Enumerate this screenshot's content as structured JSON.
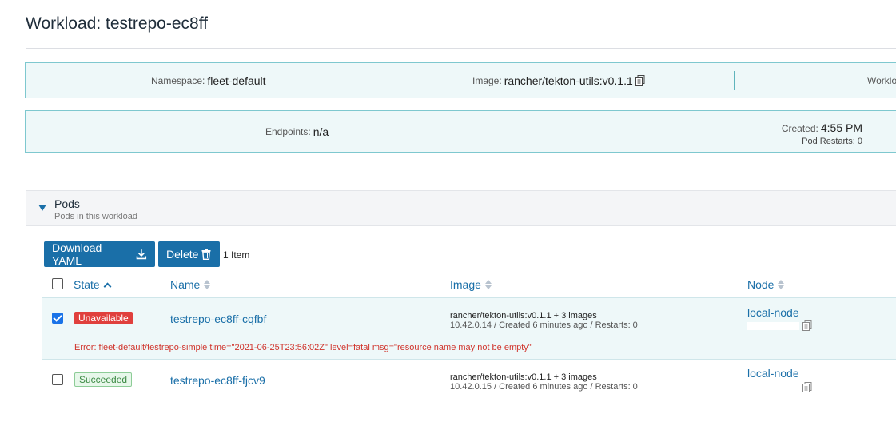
{
  "page": {
    "title": "Workload: testrepo-ec8ff"
  },
  "info": {
    "namespace_label": "Namespace:",
    "namespace_value": "fleet-default",
    "image_label": "Image:",
    "image_value": "rancher/tekton-utils:v0.1.1",
    "workload_label": "Worklo",
    "endpoints_label": "Endpoints:",
    "endpoints_value": "n/a",
    "created_label": "Created:",
    "created_value": "4:55 PM",
    "restarts_text": "Pod Restarts: 0"
  },
  "pods": {
    "title": "Pods",
    "subtitle": "Pods in this workload",
    "download_label": "Download YAML",
    "delete_label": "Delete",
    "count": "1 Item",
    "columns": {
      "state": "State",
      "name": "Name",
      "image": "Image",
      "node": "Node"
    },
    "rows": [
      {
        "checked": true,
        "state": "Unavailable",
        "name": "testrepo-ec8ff-cqfbf",
        "image": "rancher/tekton-utils:v0.1.1 + 3 images",
        "image_detail": "10.42.0.14 / Created 6 minutes ago / Restarts: 0",
        "node": "local-node",
        "error": "Error: fleet-default/testrepo-simple time=\"2021-06-25T23:56:02Z\" level=fatal msg=\"resource name may not be empty\""
      },
      {
        "checked": false,
        "state": "Succeeded",
        "name": "testrepo-ec8ff-fjcv9",
        "image": "rancher/tekton-utils:v0.1.1 + 3 images",
        "image_detail": "10.42.0.15 / Created 6 minutes ago / Restarts: 0",
        "node": "local-node"
      }
    ]
  },
  "colors": {
    "accent": "#1a6fa8",
    "error": "#d0342c",
    "info_bg": "#eef8f9",
    "info_border": "#7ec8cf"
  },
  "icons": [
    "copy-icon",
    "download-icon",
    "trash-icon",
    "collapse-triangle-icon",
    "sort-icon",
    "sort-up-icon"
  ]
}
